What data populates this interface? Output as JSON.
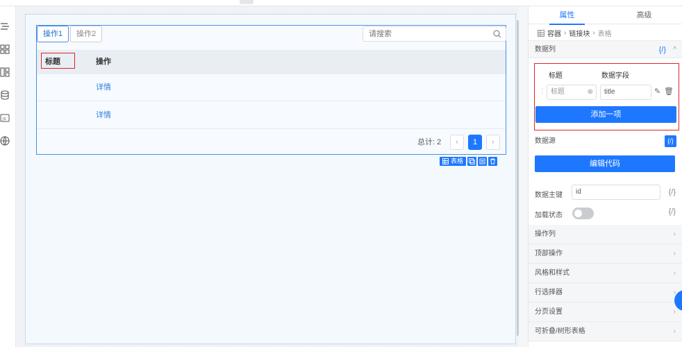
{
  "toolbar": {
    "tabs": [
      "操作1",
      "操作2"
    ],
    "search_placeholder": "请搜索"
  },
  "table": {
    "columns": [
      "标题",
      "操作"
    ],
    "rows": [
      {
        "title": "",
        "action": "详情"
      },
      {
        "title": "",
        "action": "详情"
      }
    ],
    "total_label": "总计: 2",
    "current_page": "1",
    "prev": "‹",
    "next": "›"
  },
  "component_tag": "表格",
  "panel": {
    "tabs": [
      "属性",
      "高级"
    ],
    "breadcrumb": [
      "容器",
      "链接块",
      "表格"
    ],
    "data_columns": {
      "title": "数据列",
      "code_label": "{/}",
      "header_title": "标题",
      "header_field": "数据字段",
      "row_title_value": "标题",
      "row_field_value": "title",
      "add_button": "添加一项"
    },
    "data_source": {
      "title": "数据源",
      "code_label": "{/}",
      "edit_button": "编辑代码"
    },
    "primary_key_label": "数据主键",
    "primary_key_value": "id",
    "loading_label": "加载状态",
    "code_label": "{/}",
    "collapsed_sections": [
      "操作列",
      "顶部操作",
      "风格和样式",
      "行选择器",
      "分页设置",
      "可折叠/树形表格"
    ]
  },
  "colors": {
    "accent": "#1e78ff",
    "highlight": "#e02424"
  }
}
